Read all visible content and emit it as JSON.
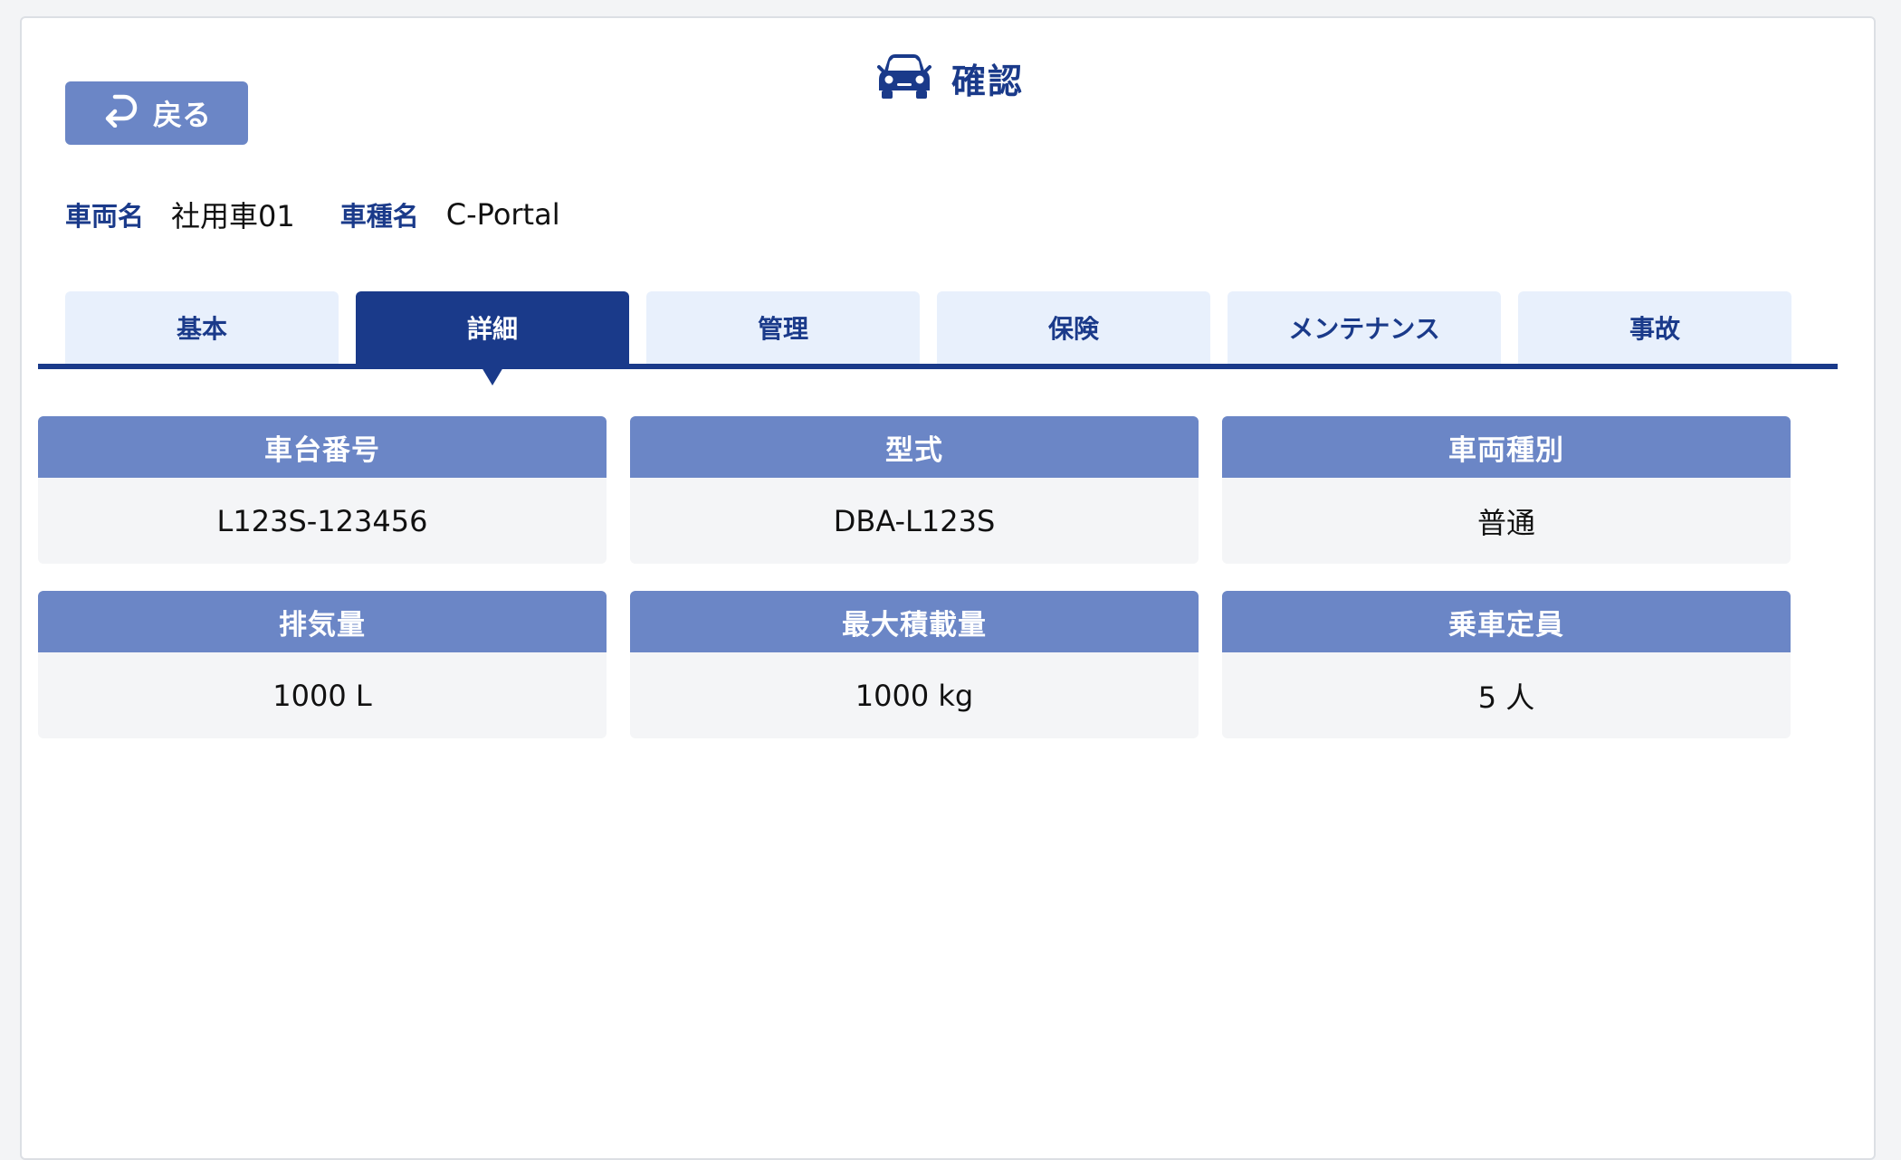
{
  "header": {
    "title": "確認",
    "icon": "car-icon"
  },
  "back_button": {
    "label": "戻る",
    "icon": "return-arrow-icon"
  },
  "vehicle": {
    "name_label": "車両名",
    "name_value": "社用車01",
    "type_label": "車種名",
    "type_value": "C-Portal"
  },
  "tabs": [
    {
      "label": "基本",
      "active": false
    },
    {
      "label": "詳細",
      "active": true
    },
    {
      "label": "管理",
      "active": false
    },
    {
      "label": "保険",
      "active": false
    },
    {
      "label": "メンテナンス",
      "active": false
    },
    {
      "label": "事故",
      "active": false
    }
  ],
  "details": [
    {
      "label": "車台番号",
      "value": "L123S-123456"
    },
    {
      "label": "型式",
      "value": "DBA-L123S"
    },
    {
      "label": "車両種別",
      "value": "普通"
    },
    {
      "label": "排気量",
      "value": "1000 L"
    },
    {
      "label": "最大積載量",
      "value": "1000 kg"
    },
    {
      "label": "乗車定員",
      "value": "5 人"
    }
  ],
  "colors": {
    "primary": "#1a3a8a",
    "header_fill": "#6b86c6",
    "tab_inactive": "#e8f0fc",
    "card_body": "#f4f5f7"
  }
}
